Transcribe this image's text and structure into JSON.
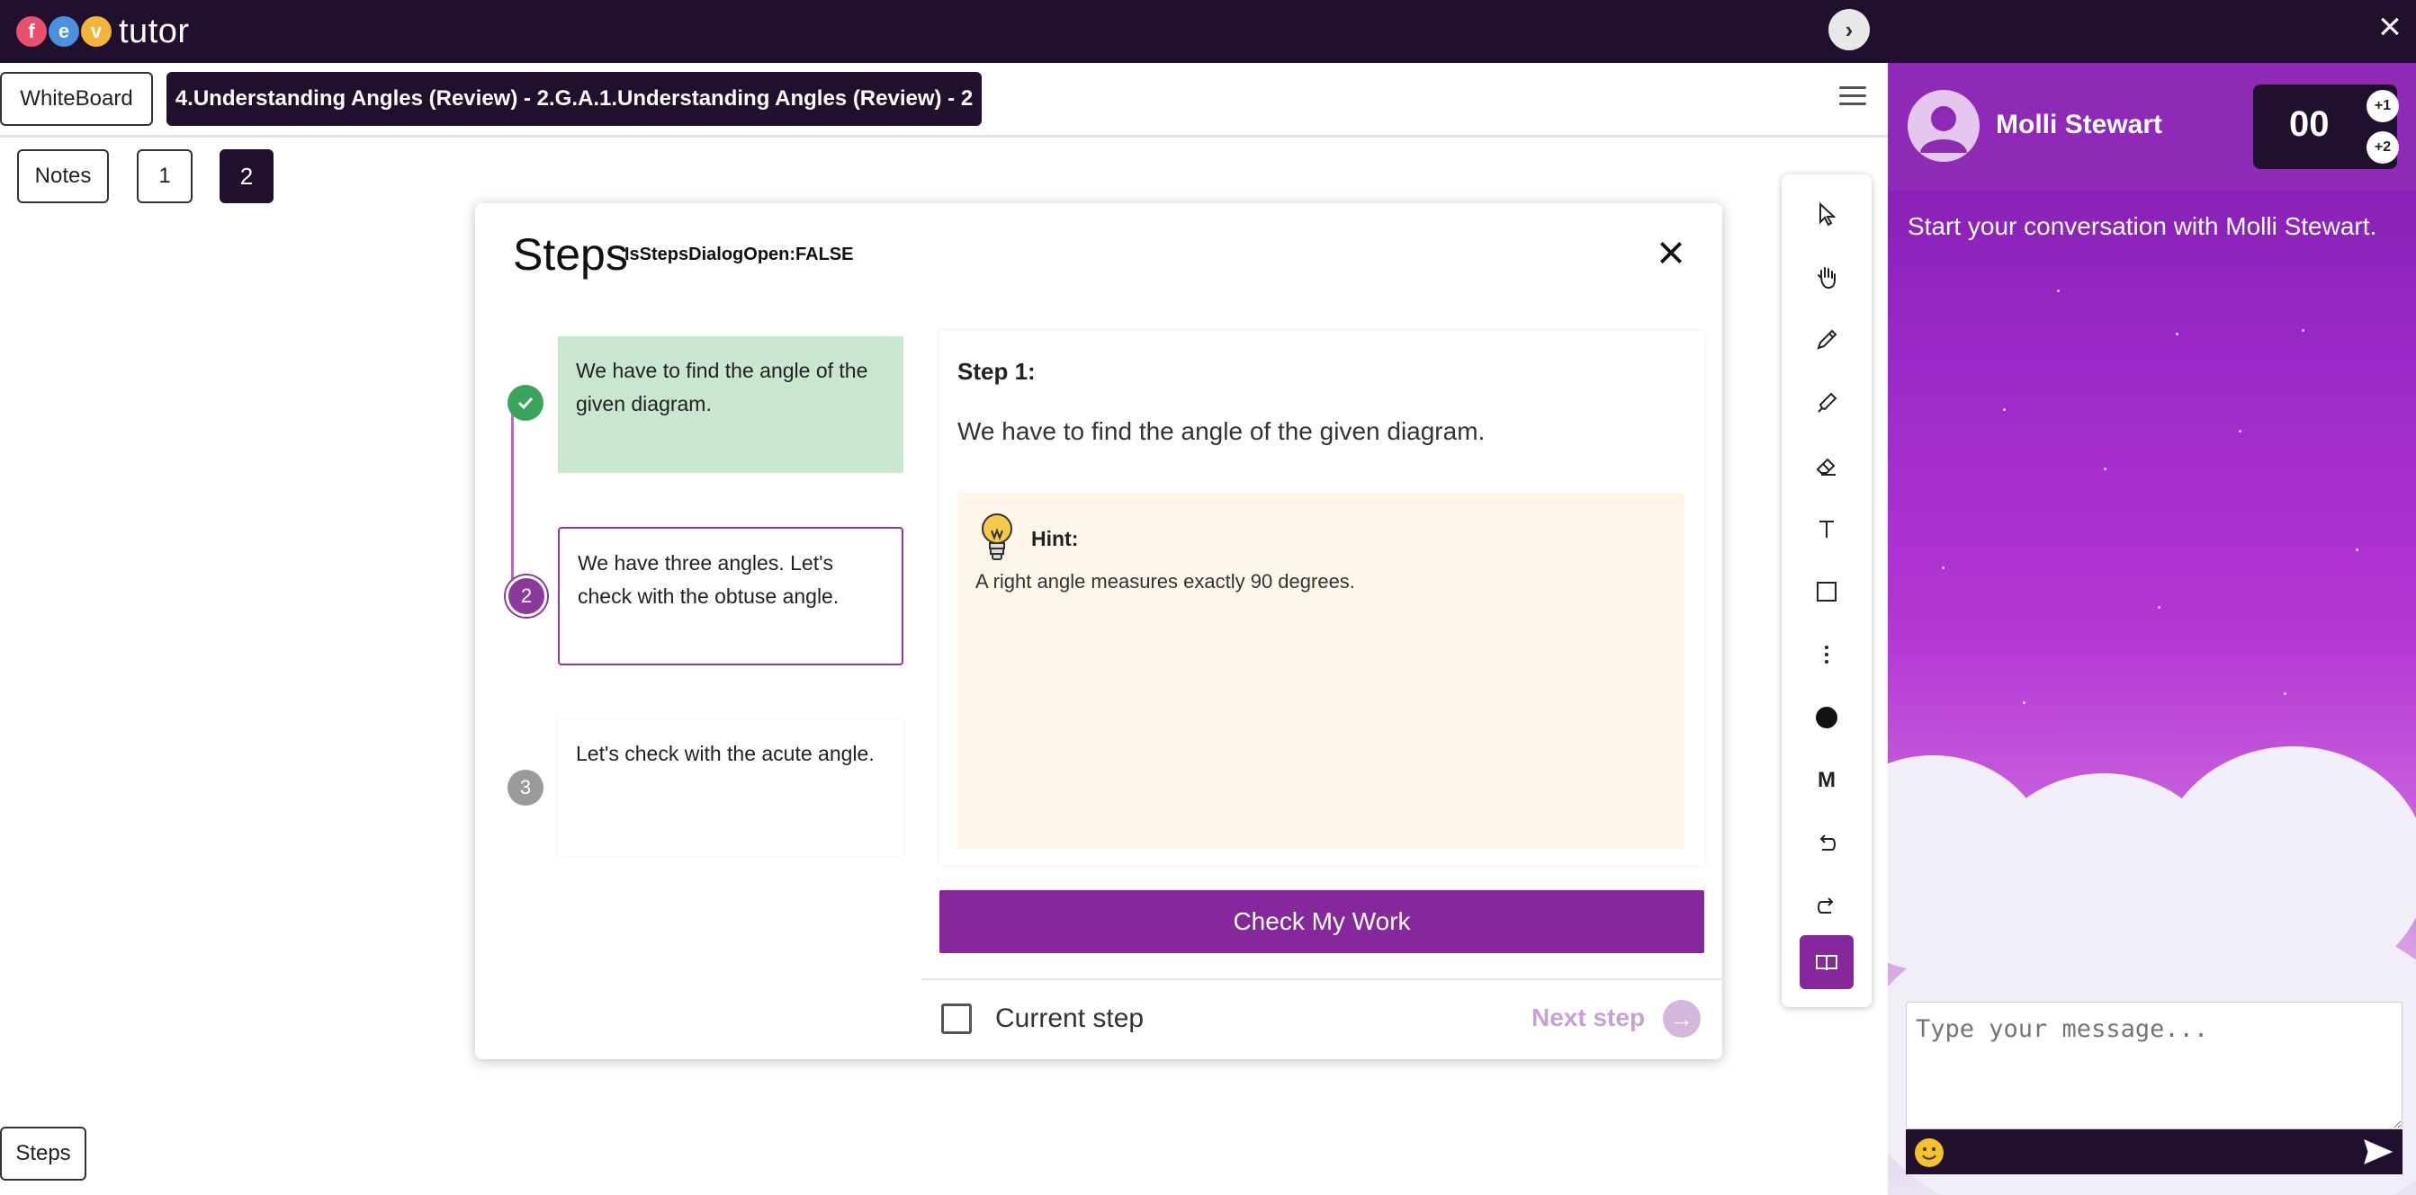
{
  "app": {
    "logo_letters": [
      "f",
      "e",
      "v"
    ],
    "logo_colors": [
      "#e8506e",
      "#4a8fe0",
      "#f2b43a"
    ],
    "logo_text": "tutor"
  },
  "whiteboard": {
    "tab_label": "WhiteBoard",
    "lesson_tab": "4.Understanding Angles (Review) - 2.G.A.1.Understanding Angles (Review) - 2",
    "pages": [
      "Notes",
      "1",
      "2"
    ],
    "active_page": "2",
    "steps_button": "Steps"
  },
  "dialog": {
    "title": "Steps",
    "debug_label": "IsStepsDialogOpen:FALSE",
    "steps": [
      {
        "number": "1",
        "text": "We have to find the angle of the given diagram.",
        "status": "done"
      },
      {
        "number": "2",
        "text": "We have three angles. Let's check with the obtuse angle.",
        "status": "current"
      },
      {
        "number": "3",
        "text": "Let's check with the acute angle.",
        "status": "upcoming"
      }
    ],
    "detail": {
      "step_label": "Step 1:",
      "text": "We have to find the angle of the given diagram.",
      "hint_label": "Hint:",
      "hint_text": "A right angle measures exactly 90 degrees."
    },
    "check_button": "Check My Work",
    "current_step_label": "Current step",
    "next_step_label": "Next step"
  },
  "tools": [
    "pointer-icon",
    "hand-icon",
    "pencil-icon",
    "highlighter-icon",
    "eraser-icon",
    "text-icon",
    "rectangle-icon",
    "more-icon",
    "color-dot-icon",
    "size-icon",
    "undo-icon",
    "redo-icon",
    "book-icon"
  ],
  "tool_size_label": "M",
  "chat": {
    "name": "Molli Stewart",
    "counter": "00",
    "plus_one": "+1",
    "plus_two": "+2",
    "intro": "Start your conversation with Molli Stewart.",
    "input_placeholder": "Type your message..."
  },
  "colors": {
    "dark": "#20102e",
    "accent": "#85289c",
    "done_step": "#c9e6cf",
    "hint_bg": "#fff7ea"
  }
}
